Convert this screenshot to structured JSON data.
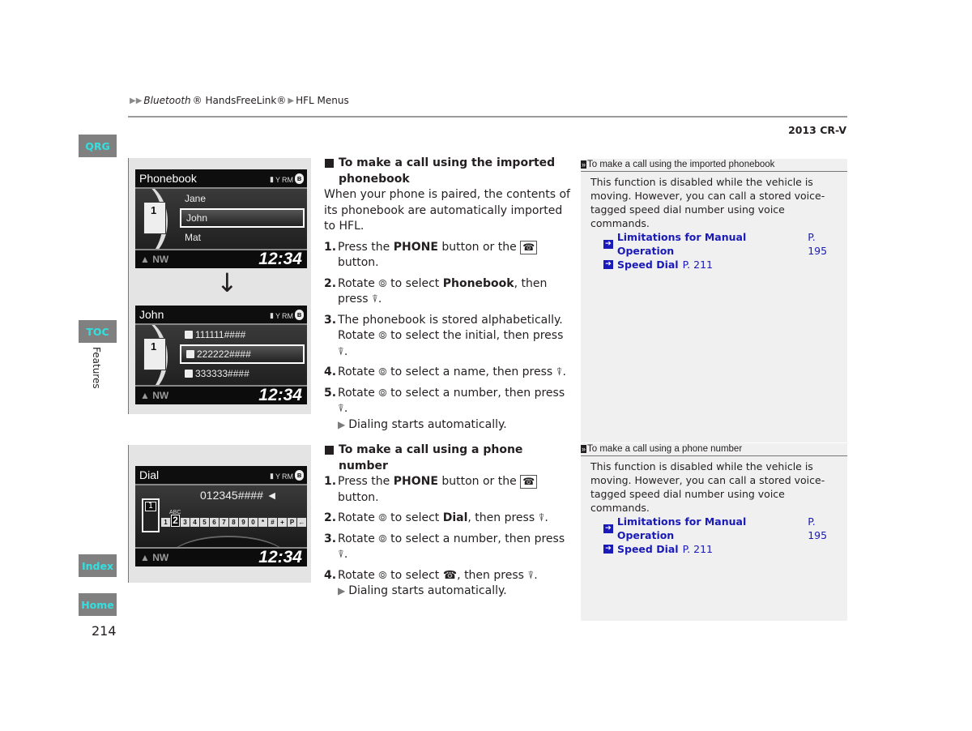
{
  "header": {
    "breadcrumb": [
      {
        "text": "Bluetooth",
        "italic": true,
        "suffix": "® HandsFreeLink®"
      },
      {
        "text": "HFL Menus"
      }
    ],
    "breadcrumb_part1": "Bluetooth",
    "breadcrumb_part1_suffix": "® HandsFreeLink®",
    "breadcrumb_part2": "HFL Menus",
    "model": "2013 CR-V"
  },
  "nav": {
    "qrg": "QRG",
    "toc": "TOC",
    "index": "Index",
    "home": "Home",
    "section": "Features",
    "page_number": "214",
    "tab_color": "#808080",
    "tab_text_color": "#33e0e0"
  },
  "screens": {
    "phonebook": {
      "title": "Phonebook",
      "book_number": "1",
      "items": [
        "Jane",
        "John",
        "Mat"
      ],
      "selected": "John",
      "heading": "NW",
      "clock": "12:34",
      "status": "RM"
    },
    "contact": {
      "title": "John",
      "book_number": "1",
      "items": [
        "111111####",
        "222222####",
        "333333####"
      ],
      "item_icons": [
        "home-phone-icon",
        "mobile-phone-icon",
        "star-icon"
      ],
      "selected": "222222####",
      "heading": "NW",
      "clock": "12:34",
      "status": "RM"
    },
    "dial": {
      "title": "Dial",
      "number": "012345#### ◄",
      "phone_digit": "1",
      "abc_label": "ABC",
      "keys": [
        "1",
        "2",
        "3",
        "4",
        "5",
        "6",
        "7",
        "8",
        "9",
        "0",
        "*",
        "#",
        "+",
        "P",
        "←"
      ],
      "selected_key": "2",
      "heading": "NW",
      "clock": "12:34",
      "status": "RM"
    },
    "arrow": "↓"
  },
  "section1": {
    "title": "To make a call using the imported phonebook",
    "intro": "When your phone is paired, the contents of its phonebook are automatically imported to HFL.",
    "steps": [
      {
        "n": "1.",
        "pre": "Press the ",
        "bold": "PHONE",
        "post": " button or the",
        "post2": "button."
      },
      {
        "n": "2.",
        "pre": "Rotate",
        "mid": "to select ",
        "bold": "Phonebook",
        "post": ", then press"
      },
      {
        "n": "3.",
        "text": "The phonebook is stored alphabetically. Rotate",
        "post": "to select the initial, then press"
      },
      {
        "n": "4.",
        "pre": "Rotate",
        "post": "to select a name, then press"
      },
      {
        "n": "5.",
        "pre": "Rotate",
        "post": "to select a number, then press"
      }
    ],
    "result": "Dialing starts automatically."
  },
  "section2": {
    "title": "To make a call using a phone number",
    "steps": [
      {
        "n": "1.",
        "pre": "Press the ",
        "bold": "PHONE",
        "post": " button or the",
        "post2": "button."
      },
      {
        "n": "2.",
        "pre": "Rotate",
        "mid": "to select ",
        "bold": "Dial",
        "post": ", then press"
      },
      {
        "n": "3.",
        "pre": "Rotate",
        "post": "to select a number, then press"
      },
      {
        "n": "4.",
        "pre": "Rotate",
        "mid": "to select",
        "post": ", then press"
      }
    ],
    "result": "Dialing starts automatically."
  },
  "sidebar1": {
    "title": "To make a call using the imported phonebook",
    "body": "This function is disabled while the vehicle is moving. However, you can call a stored voice-tagged speed dial number using voice commands.",
    "refs": [
      {
        "label": "Limitations for Manual Operation",
        "page": "P. 195"
      },
      {
        "label": "Speed Dial",
        "page": "P. 211"
      }
    ]
  },
  "sidebar2": {
    "title": "To make a call using a phone number",
    "body": "This function is disabled while the vehicle is moving. However, you can call a stored voice-tagged speed dial number using voice commands.",
    "refs": [
      {
        "label": "Limitations for Manual Operation",
        "page": "P. 195"
      },
      {
        "label": "Speed Dial",
        "page": "P. 211"
      }
    ]
  },
  "colors": {
    "link": "#1a1ab8",
    "sidebar_bg": "#f0f0f0"
  }
}
